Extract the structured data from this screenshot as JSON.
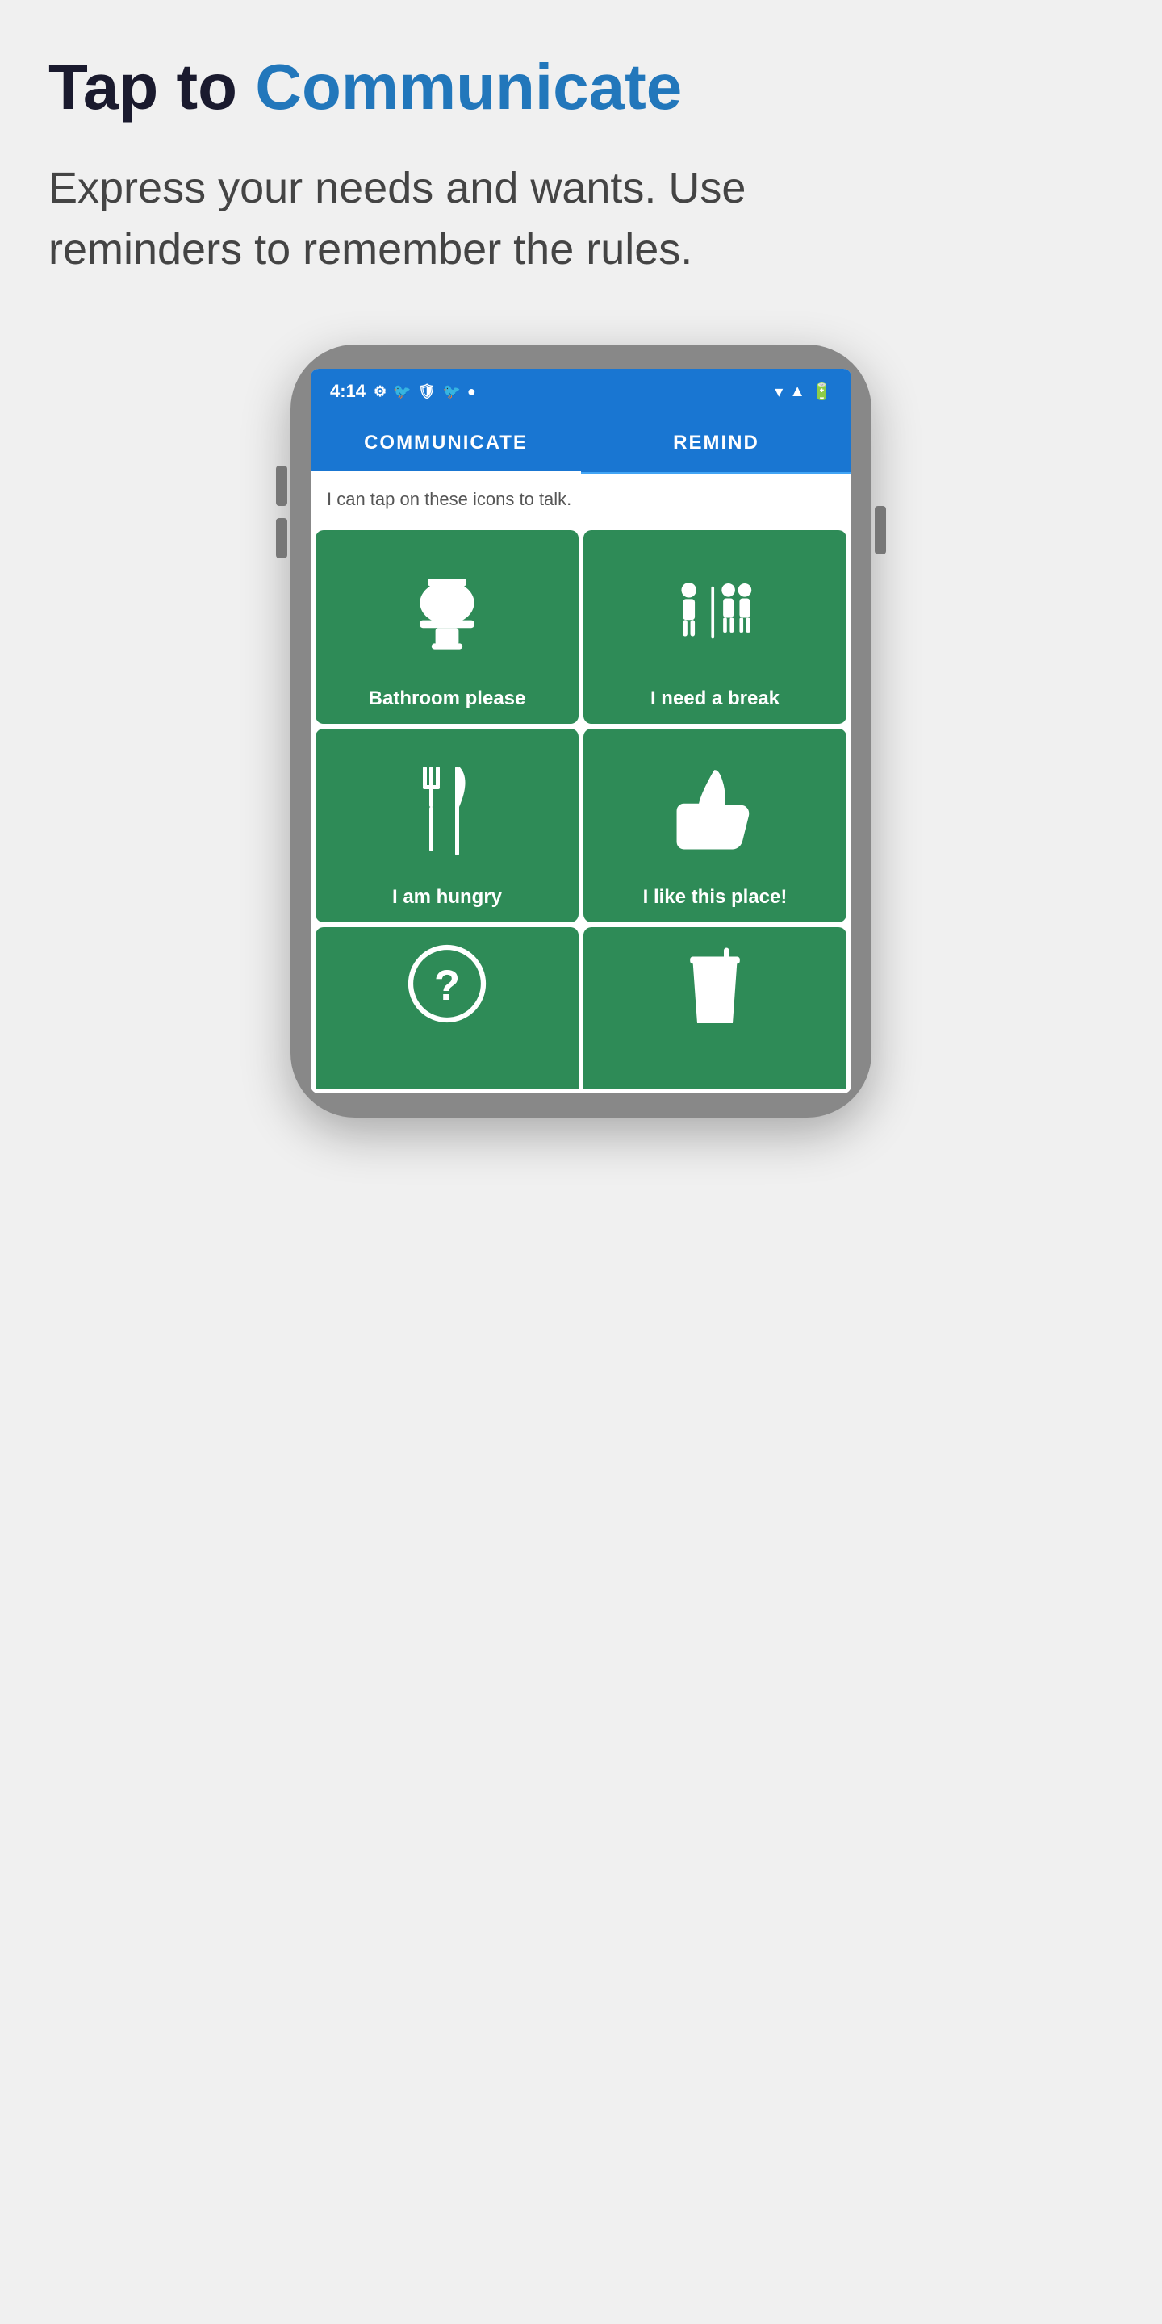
{
  "header": {
    "title_prefix": "Tap to ",
    "title_highlight": "Communicate",
    "subtitle": "Express your needs and wants. Use reminders to remember the rules."
  },
  "phone": {
    "status_bar": {
      "time": "4:14",
      "icons": [
        "gear",
        "bird1",
        "shield",
        "bird2",
        "dot"
      ],
      "right_icons": [
        "wifi",
        "signal",
        "battery"
      ]
    },
    "tabs": [
      {
        "id": "communicate",
        "label": "COMMUNICATE",
        "active": true
      },
      {
        "id": "remind",
        "label": "REMIND",
        "active": false
      }
    ],
    "hint": "I can tap on these icons to talk.",
    "grid_items": [
      {
        "id": "bathroom",
        "label": "Bathroom please",
        "icon": "toilet"
      },
      {
        "id": "break",
        "label": "I need a break",
        "icon": "break"
      },
      {
        "id": "hungry",
        "label": "I am hungry",
        "icon": "fork-knife"
      },
      {
        "id": "like",
        "label": "I like this place!",
        "icon": "thumbs-up"
      },
      {
        "id": "question",
        "label": "?",
        "icon": "question"
      },
      {
        "id": "drink",
        "label": "drink",
        "icon": "cup"
      }
    ]
  },
  "colors": {
    "blue_accent": "#2277bb",
    "green_cell": "#2e8b57",
    "app_blue": "#1976d2",
    "dark_text": "#1a1a2e",
    "gray_text": "#444"
  }
}
